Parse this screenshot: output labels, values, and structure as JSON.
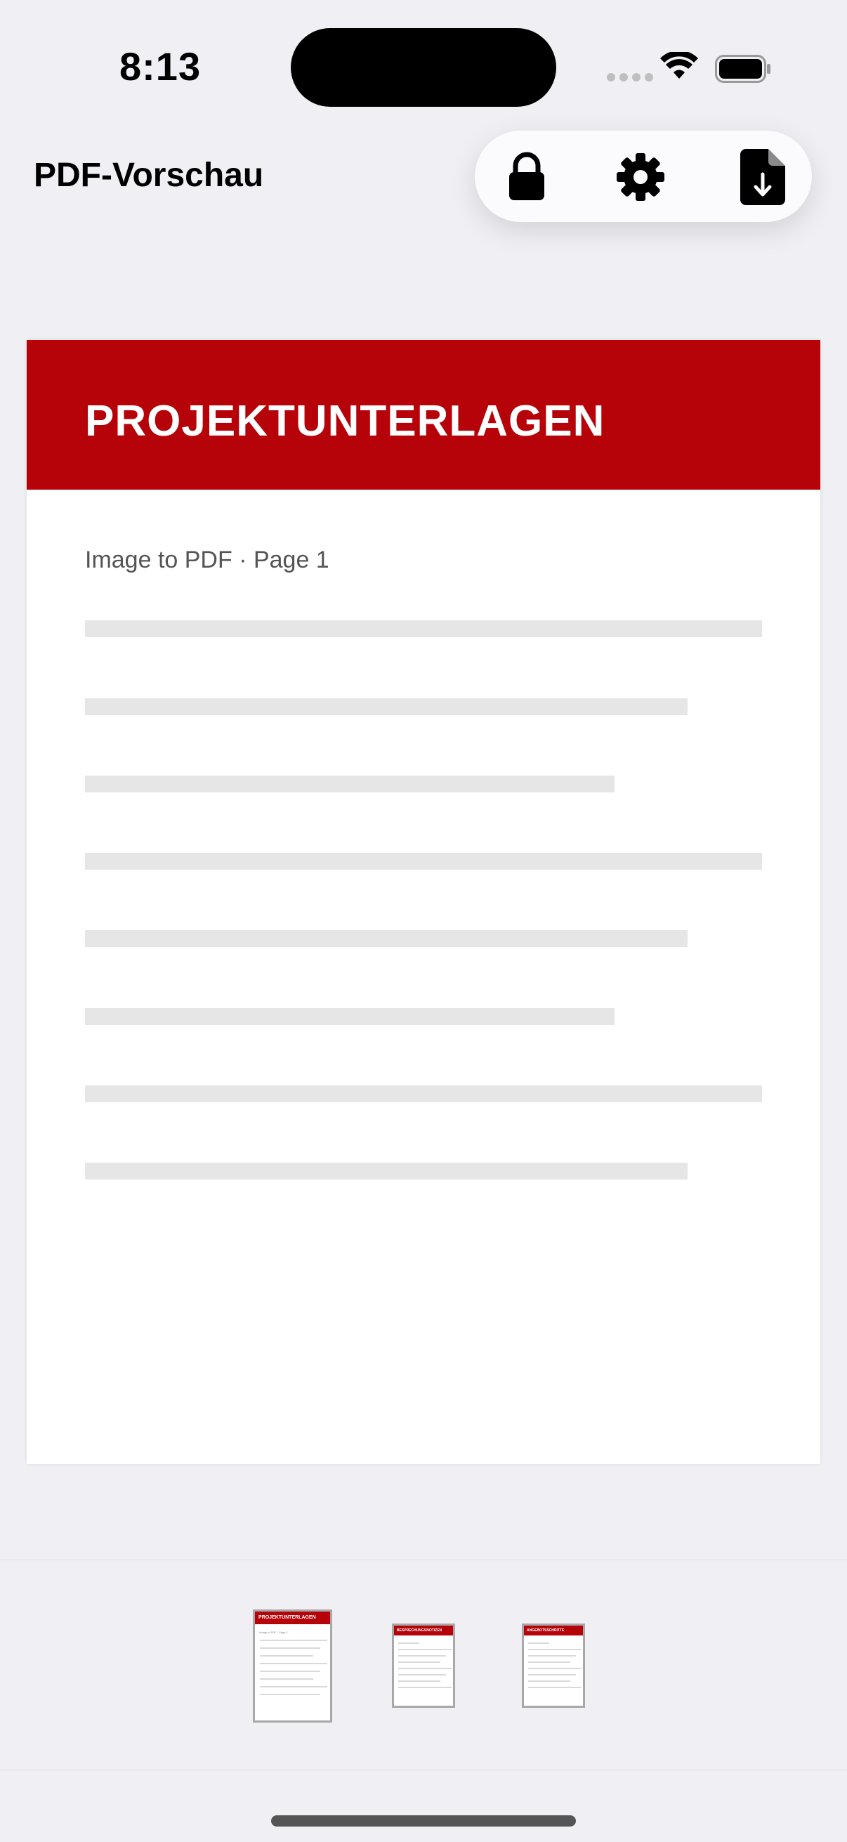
{
  "status": {
    "time": "8:13"
  },
  "header": {
    "title": "PDF-Vorschau",
    "tools": [
      {
        "icon": "lock-icon"
      },
      {
        "icon": "gear-icon"
      },
      {
        "icon": "document-download-icon"
      }
    ]
  },
  "preview": {
    "title": "PROJEKTUNTERLAGEN",
    "subtitle": "Image to PDF · Page 1",
    "accent": "#b50309"
  },
  "thumbnails": [
    {
      "title": "PROJEKTUNTERLAGEN",
      "subtitle": "Image to PDF · Page 1",
      "selected": true
    },
    {
      "title": "BESPRECHUNGSNOTIZEN",
      "selected": false
    },
    {
      "title": "ANGEBOTSSCHRITTE",
      "selected": false
    }
  ]
}
